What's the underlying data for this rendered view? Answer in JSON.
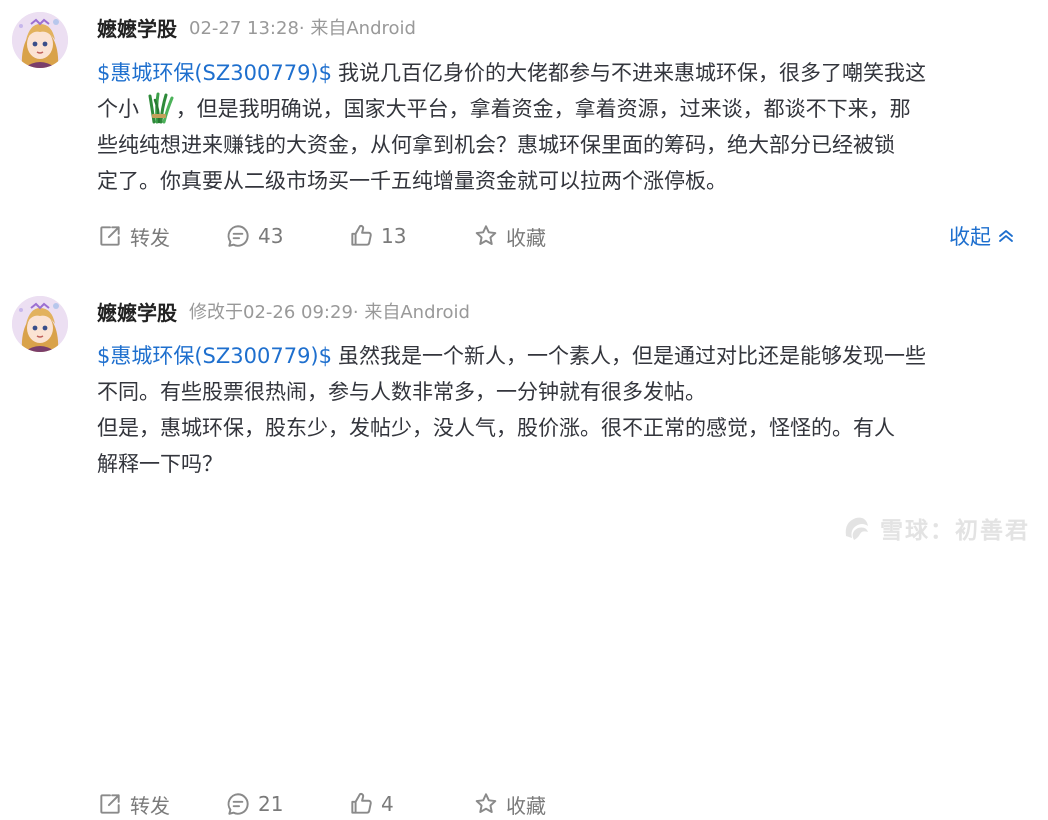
{
  "posts": [
    {
      "author": "嬷嬷学股",
      "meta": "02-27 13:28· 来自Android",
      "stock_tag": "$惠城环保(SZ300779)$",
      "line1_text": "我说几百亿身价的大佬都参与不进来惠城环保，很多了嘲笑我这",
      "line2_before": "个小",
      "line2_after": "，但是我明确说，国家大平台，拿着资金，拿着资源，过来谈，都谈不下来，那",
      "line3": "些纯纯想进来赚钱的大资金，从何拿到机会？惠城环保里面的筹码，绝大部分已经被锁",
      "line4": "定了。你真要从二级市场买一千五纯增量资金就可以拉两个涨停板。",
      "emoji_icon": "chives-icon",
      "actions": {
        "repost": "转发",
        "comments": "43",
        "likes": "13",
        "favorite": "收藏"
      },
      "collapse": "收起"
    },
    {
      "author": "嬷嬷学股",
      "meta": "修改于02-26 09:29· 来自Android",
      "stock_tag": "$惠城环保(SZ300779)$",
      "line1_text": "虽然我是一个新人，一个素人，但是通过对比还是能够发现一些",
      "line2": "不同。有些股票很热闹，参与人数非常多，一分钟就有很多发帖。",
      "line3": "但是，惠城环保，股东少，发帖少，没人气，股价涨。很不正常的感觉，怪怪的。有人",
      "line4": "解释一下吗？",
      "actions": {
        "repost": "转发",
        "comments": "21",
        "likes": "4",
        "favorite": "收藏"
      }
    }
  ],
  "watermark": "雪球：初善君",
  "colors": {
    "link": "#1e6fce",
    "meta": "#999999",
    "text": "#33353c"
  }
}
